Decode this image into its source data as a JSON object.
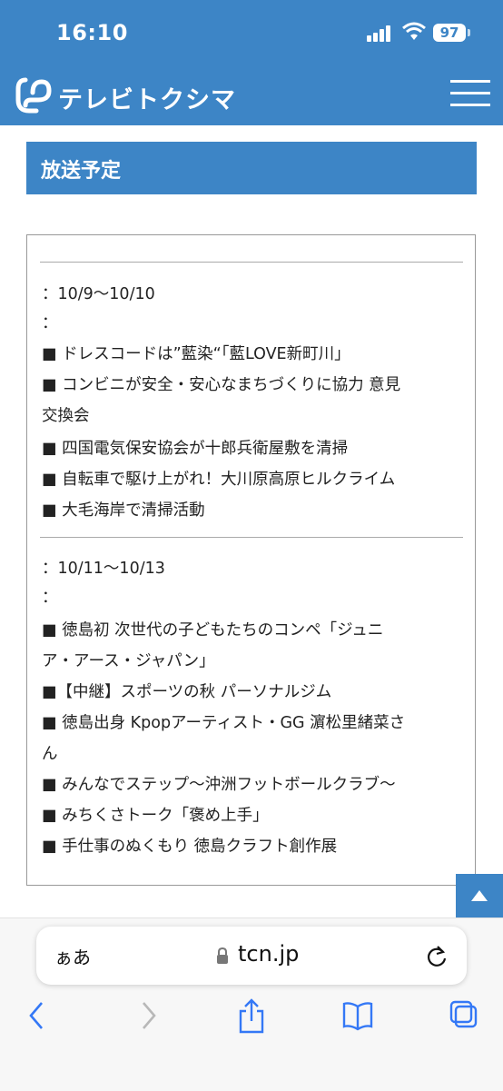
{
  "status_bar": {
    "time": "16:10",
    "battery": "97"
  },
  "header": {
    "site_name": "テレビトクシマ"
  },
  "section": {
    "title": "放送予定"
  },
  "schedule": [
    {
      "date": "：10/9〜10/10",
      "sub": "：",
      "items": [
        "■ ドレスコードは”藍染“「藍LOVE新町川」",
        "■ コンビニが安全・安心なまちづくりに協力 意見",
        "交換会",
        "■ 四国電気保安協会が十郎兵衛屋敷を清掃",
        "■ 自転車で駆け上がれ！大川原高原ヒルクライム",
        "■ 大毛海岸で清掃活動"
      ]
    },
    {
      "date": "：10/11〜10/13",
      "sub": "：",
      "items": [
        "■ 徳島初 次世代の子どもたちのコンペ「ジュニ",
        "ア・アース・ジャパン」",
        "■【中継】スポーツの秋 パーソナルジム",
        "■ 徳島出身 Kpopアーティスト・GG 濵松里緒菜さ",
        "ん",
        "■ みんなでステップ〜沖洲フットボールクラブ〜",
        "■ みちくさトーク「褒め上手」",
        "■ 手仕事のぬくもり 徳島クラフト創作展"
      ]
    }
  ],
  "browser": {
    "aa_label": "ぁあ",
    "url": "tcn.jp"
  },
  "colors": {
    "brand_blue": "#3d85c6"
  },
  "icons": [
    "signal-icon",
    "wifi-icon",
    "battery-icon",
    "logo-icon",
    "hamburger-menu-icon",
    "back-to-top-icon",
    "lock-icon",
    "reload-icon",
    "back-icon",
    "forward-icon",
    "share-icon",
    "bookmarks-icon",
    "tabs-icon"
  ]
}
